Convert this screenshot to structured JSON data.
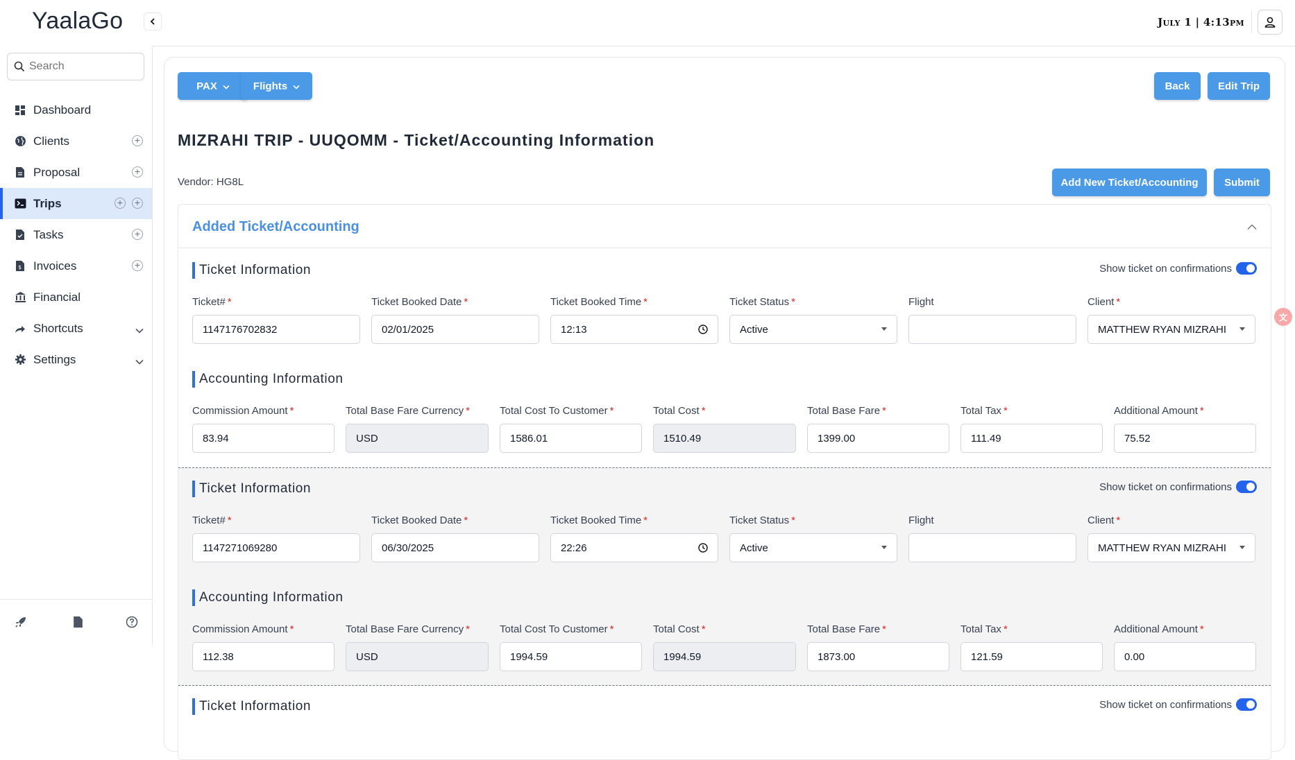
{
  "app": {
    "logo": "YaalaGo",
    "datetime": "July 1 | 4:13pm"
  },
  "sidebar": {
    "search_placeholder": "Search",
    "items": [
      {
        "label": "Dashboard",
        "icon": "dashboard-icon"
      },
      {
        "label": "Clients",
        "icon": "globe-icon"
      },
      {
        "label": "Proposal",
        "icon": "document-icon"
      },
      {
        "label": "Trips",
        "icon": "terminal-icon"
      },
      {
        "label": "Tasks",
        "icon": "task-icon"
      },
      {
        "label": "Invoices",
        "icon": "invoice-icon"
      },
      {
        "label": "Financial",
        "icon": "bank-icon"
      },
      {
        "label": "Shortcuts",
        "icon": "share-icon"
      },
      {
        "label": "Settings",
        "icon": "gear-icon"
      }
    ]
  },
  "toolbar": {
    "pax": "PAX",
    "flights": "Flights",
    "back": "Back",
    "edit_trip": "Edit Trip"
  },
  "page": {
    "title": "MIZRAHI TRIP - UUQOMM - Ticket/Accounting Information",
    "vendor": "Vendor: HG8L",
    "add_button": "Add New Ticket/Accounting",
    "submit_button": "Submit",
    "section_title": "Added Ticket/Accounting"
  },
  "labels": {
    "ticket_information": "Ticket Information",
    "accounting_information": "Accounting Information",
    "show_ticket": "Show ticket on confirmations",
    "ticket_no": "Ticket#",
    "booked_date": "Ticket Booked Date",
    "booked_time": "Ticket Booked Time",
    "status": "Ticket Status",
    "flight": "Flight",
    "client": "Client",
    "commission": "Commission Amount",
    "base_fare_currency": "Total Base Fare Currency",
    "cost_to_customer": "Total Cost To Customer",
    "total_cost": "Total Cost",
    "base_fare": "Total Base Fare",
    "total_tax": "Total Tax",
    "additional_amount": "Additional Amount"
  },
  "tickets": [
    {
      "ticket_no": "1147176702832",
      "booked_date": "02/01/2025",
      "booked_time": "12:13",
      "status": "Active",
      "flight": "",
      "client": "MATTHEW RYAN MIZRAHI",
      "commission": "83.94",
      "currency": "USD",
      "cost_to_customer": "1586.01",
      "total_cost": "1510.49",
      "base_fare": "1399.00",
      "total_tax": "111.49",
      "additional_amount": "75.52"
    },
    {
      "ticket_no": "1147271069280",
      "booked_date": "06/30/2025",
      "booked_time": "22:26",
      "status": "Active",
      "flight": "",
      "client": "MATTHEW RYAN MIZRAHI",
      "commission": "112.38",
      "currency": "USD",
      "cost_to_customer": "1994.59",
      "total_cost": "1994.59",
      "base_fare": "1873.00",
      "total_tax": "121.59",
      "additional_amount": "0.00"
    }
  ],
  "colors": {
    "primary_button": "#4a9ae8",
    "active_nav": "#dbe9fb",
    "accent": "#2563eb",
    "section_title": "#4a90e2"
  }
}
